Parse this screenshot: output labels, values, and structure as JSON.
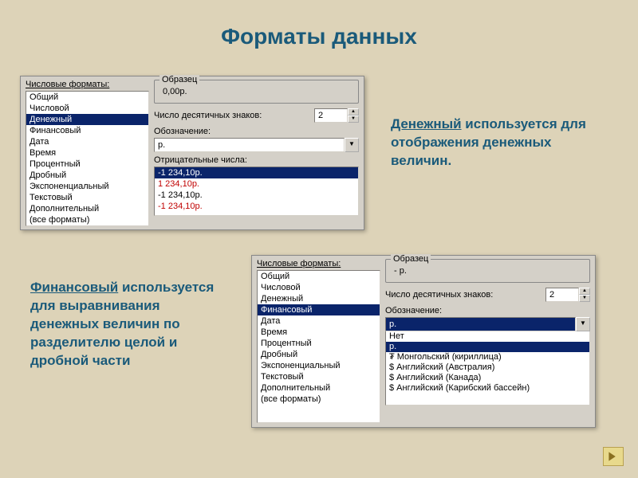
{
  "slide": {
    "title": "Форматы данных"
  },
  "desc1": {
    "bold": "Денежный",
    "rest": " используется для отображения денежных величин."
  },
  "desc2": {
    "bold": "Финансовый",
    "rest": " используется для выравнивания денежных величин по разделителю целой и дробной части"
  },
  "panel1": {
    "categories_label": "Числовые форматы:",
    "items": [
      "Общий",
      "Числовой",
      "Денежный",
      "Финансовый",
      "Дата",
      "Время",
      "Процентный",
      "Дробный",
      "Экспоненциальный",
      "Текстовый",
      "Дополнительный",
      "(все форматы)"
    ],
    "selected": "Денежный",
    "sample_label": "Образец",
    "sample_value": "0,00р.",
    "decimals_label": "Число десятичных знаков:",
    "decimals": "2",
    "symbol_label": "Обозначение:",
    "symbol_value": "р.",
    "neg_label": "Отрицательные числа:",
    "neg_items": [
      "-1 234,10р.",
      "1 234,10р.",
      "-1 234,10р.",
      "-1 234,10р."
    ]
  },
  "panel2": {
    "categories_label": "Числовые форматы:",
    "items": [
      "Общий",
      "Числовой",
      "Денежный",
      "Финансовый",
      "Дата",
      "Время",
      "Процентный",
      "Дробный",
      "Экспоненциальный",
      "Текстовый",
      "Дополнительный",
      "(все форматы)"
    ],
    "selected": "Финансовый",
    "sample_label": "Образец",
    "sample_value": "-   р.",
    "decimals_label": "Число десятичных знаков:",
    "decimals": "2",
    "symbol_label": "Обозначение:",
    "symbol_value": "р.",
    "options": [
      "Нет",
      "р.",
      "₮ Монгольский (кириллица)",
      "$ Английский (Австралия)",
      "$ Английский (Канада)",
      "$ Английский (Карибский бассейн)"
    ],
    "option_selected": "р."
  }
}
